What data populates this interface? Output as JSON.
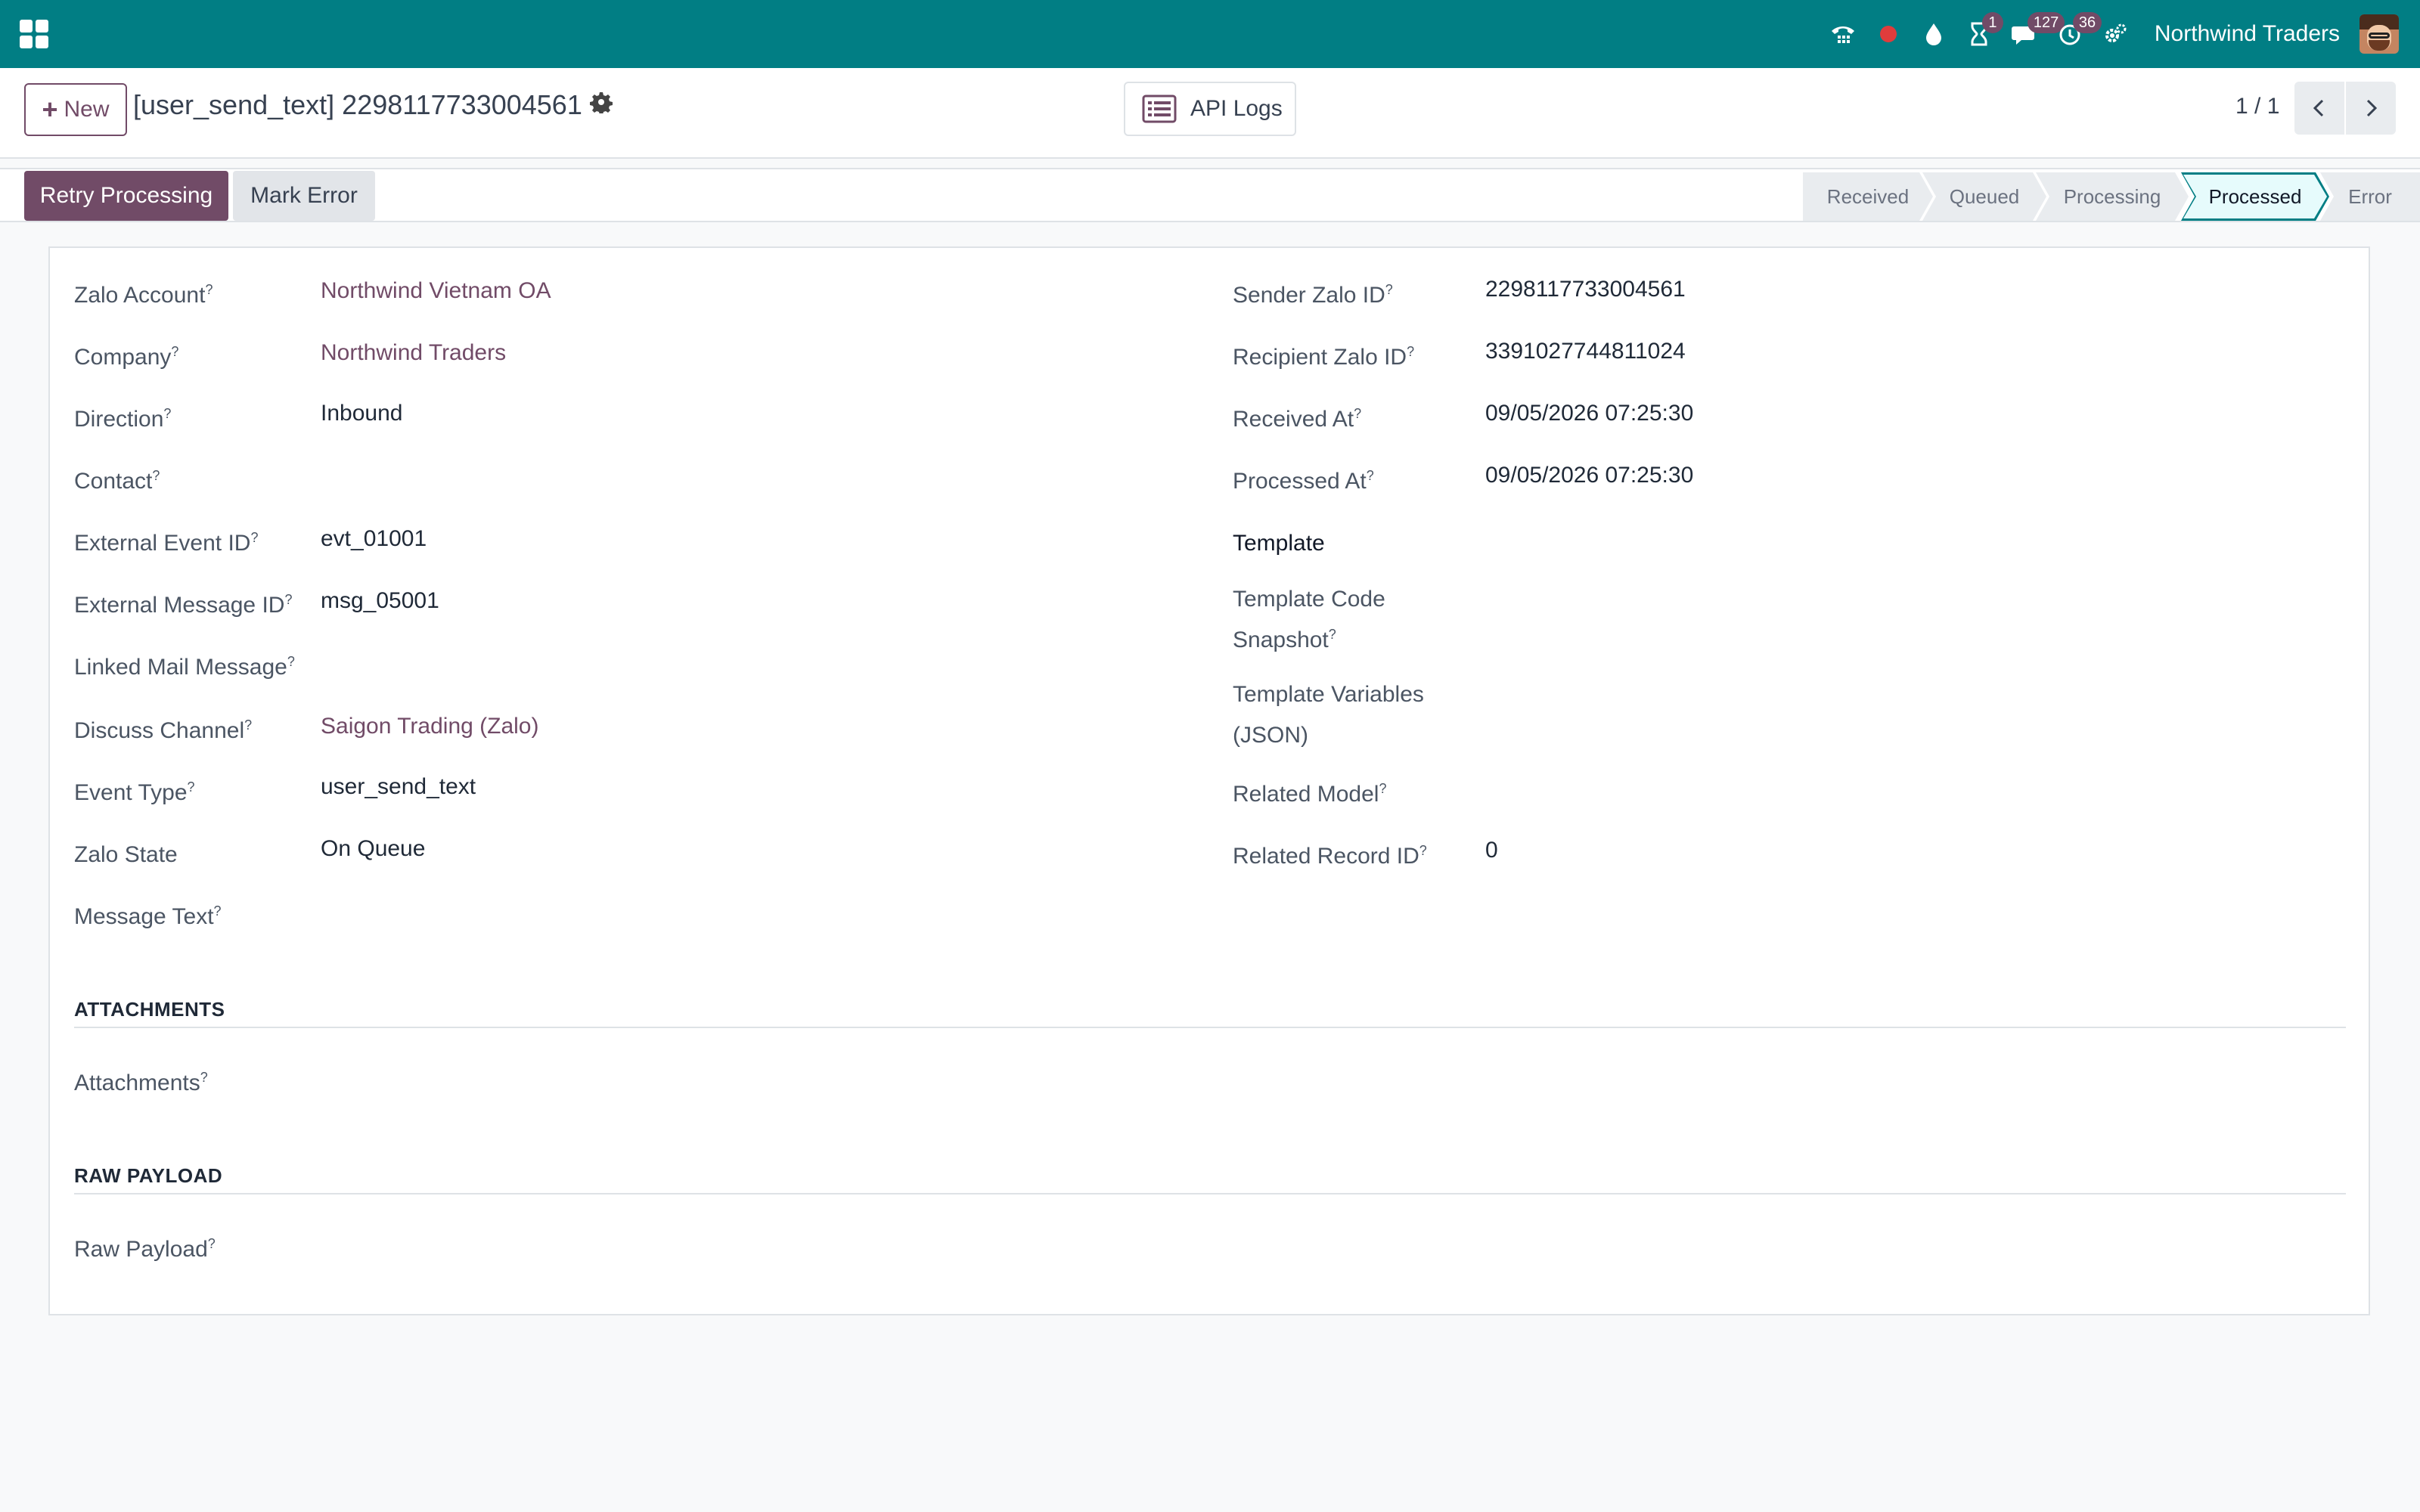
{
  "navbar": {
    "company": "Northwind Traders",
    "badges": {
      "activities": "1",
      "messages": "127",
      "timesheets": "36"
    },
    "color": "#017e84"
  },
  "control_panel": {
    "new_label": "New",
    "record_title": "[user_send_text] 2298117733004561",
    "api_logs_label": "API Logs",
    "pager": "1 / 1"
  },
  "statusbar": {
    "retry_label": "Retry Processing",
    "mark_error_label": "Mark Error",
    "stages": [
      "Received",
      "Queued",
      "Processing",
      "Processed",
      "Error"
    ],
    "active_stage": "Processed",
    "accent": "#714b67"
  },
  "form": {
    "left": [
      {
        "label": "Zalo Account",
        "help": "?",
        "value": "Northwind Vietnam OA",
        "link": true
      },
      {
        "label": "Company",
        "help": "?",
        "value": "Northwind Traders",
        "link": true
      },
      {
        "label": "Direction",
        "help": "?",
        "value": "Inbound"
      },
      {
        "label": "Contact",
        "help": "?",
        "value": ""
      },
      {
        "label": "External Event ID",
        "help": "?",
        "value": "evt_01001"
      },
      {
        "label": "External Message ID",
        "help": "?",
        "value": "msg_05001"
      },
      {
        "label": "Linked Mail Message",
        "help": "?",
        "value": ""
      },
      {
        "label": "Discuss Channel",
        "help": "?",
        "value": "Saigon Trading (Zalo)",
        "link": true
      },
      {
        "label": "Event Type",
        "help": "?",
        "value": "user_send_text"
      },
      {
        "label": "Zalo State",
        "help": "",
        "value": "On Queue"
      },
      {
        "label": "Message Text",
        "help": "?",
        "value": ""
      }
    ],
    "right": [
      {
        "label": "Sender Zalo ID",
        "help": "?",
        "value": "2298117733004561"
      },
      {
        "label": "Recipient Zalo ID",
        "help": "?",
        "value": "3391027744811024"
      },
      {
        "label": "Received At",
        "help": "?",
        "value": "09/05/2026 07:25:30"
      },
      {
        "label": "Processed At",
        "help": "?",
        "value": "09/05/2026 07:25:30"
      },
      {
        "label": "Template",
        "help": "",
        "value": ""
      },
      {
        "label": "Template Code",
        "label2": "Snapshot",
        "help": "?",
        "value": ""
      },
      {
        "label": "Template Variables",
        "label2": "(JSON)",
        "help": "",
        "value": ""
      },
      {
        "label": "Related Model",
        "help": "?",
        "value": ""
      },
      {
        "label": "Related Record ID",
        "help": "?",
        "value": "0"
      }
    ],
    "sections": {
      "attachments_title": "ATTACHMENTS",
      "attachments_label": "Attachments",
      "raw_title": "RAW PAYLOAD",
      "raw_label": "Raw Payload",
      "help": "?"
    }
  }
}
